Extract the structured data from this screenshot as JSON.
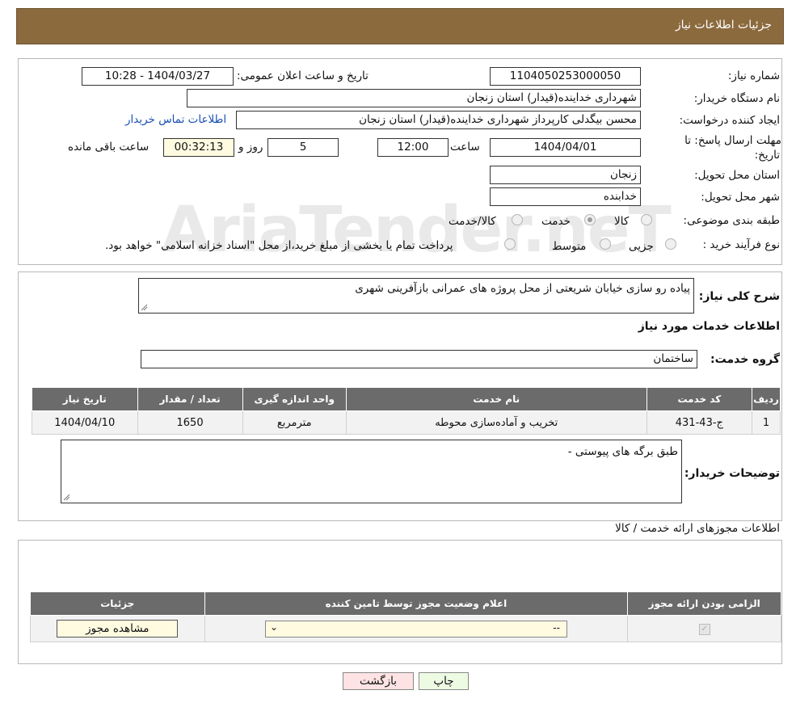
{
  "header": {
    "title": "جزئیات اطلاعات نیاز"
  },
  "form": {
    "need_number_label": "شماره نیاز:",
    "need_number": "1104050253000050",
    "announce_label": "تاریخ و ساعت اعلان عمومی:",
    "announce_value": "1404/03/27 - 10:28",
    "buyer_org_label": "نام دستگاه خریدار:",
    "buyer_org": "شهرداری خداینده(قیدار) استان زنجان",
    "creator_label": "ایجاد کننده درخواست:",
    "creator": "محسن بیگدلی کارپرداز شهرداری خداینده(قیدار) استان زنجان",
    "contact_link": "اطلاعات تماس خریدار",
    "deadline_label_1": "مهلت ارسال پاسخ: تا",
    "deadline_label_2": "تاریخ:",
    "deadline_date": "1404/04/01",
    "time_label": "ساعت",
    "deadline_time": "12:00",
    "days_value": "5",
    "days_label": "روز و",
    "remaining_time": "00:32:13",
    "remaining_label": "ساعت باقی مانده",
    "province_label": "استان محل تحویل:",
    "province": "زنجان",
    "city_label": "شهر محل تحویل:",
    "city": "خدابنده",
    "category_label": "طبقه بندی موضوعی:",
    "category_options": [
      "کالا",
      "خدمت",
      "کالا/خدمت"
    ],
    "category_selected": "خدمت",
    "process_label": "نوع فرآیند خرید :",
    "process_options": [
      "جزیی",
      "متوسط"
    ],
    "process_note": "پرداخت تمام یا بخشی از مبلغ خرید،از محل \"اسناد خزانه اسلامی\" خواهد بود."
  },
  "description": {
    "label": "شرح کلی نیاز:",
    "value": "پیاده رو سازی خیابان شریعتی از محل پروژه های عمرانی بازآفرینی شهری"
  },
  "services": {
    "title": "اطلاعات خدمات مورد نیاز",
    "group_label": "گروه خدمت:",
    "group_value": "ساختمان",
    "columns": [
      "ردیف",
      "کد خدمت",
      "نام خدمت",
      "واحد اندازه گیری",
      "تعداد / مقدار",
      "تاریخ نیاز"
    ],
    "rows": [
      [
        "1",
        "ج-43-431",
        "تخریب و آماده‌سازی محوطه",
        "مترمربع",
        "1650",
        "1404/04/10"
      ]
    ]
  },
  "buyer_notes": {
    "label": "توضیحات خریدار:",
    "value": "طبق برگه های پیوستی -"
  },
  "permits": {
    "title": "اطلاعات مجوزهای ارائه خدمت / کالا",
    "columns": [
      "الزامی بودن ارائه مجوز",
      "اعلام وضعیت مجوز توسط تامین کننده",
      "جزئیات"
    ],
    "select_value": "--",
    "view_button": "مشاهده مجوز"
  },
  "buttons": {
    "print": "چاپ",
    "back": "بازگشت"
  },
  "watermark": "AriaTender.neT",
  "colors": {
    "header_bg": "#8b6a3e",
    "table_header": "#6b6b6b",
    "link": "#1a4fb4",
    "back_btn": "#fde3e3",
    "print_btn": "#eefbe3"
  }
}
